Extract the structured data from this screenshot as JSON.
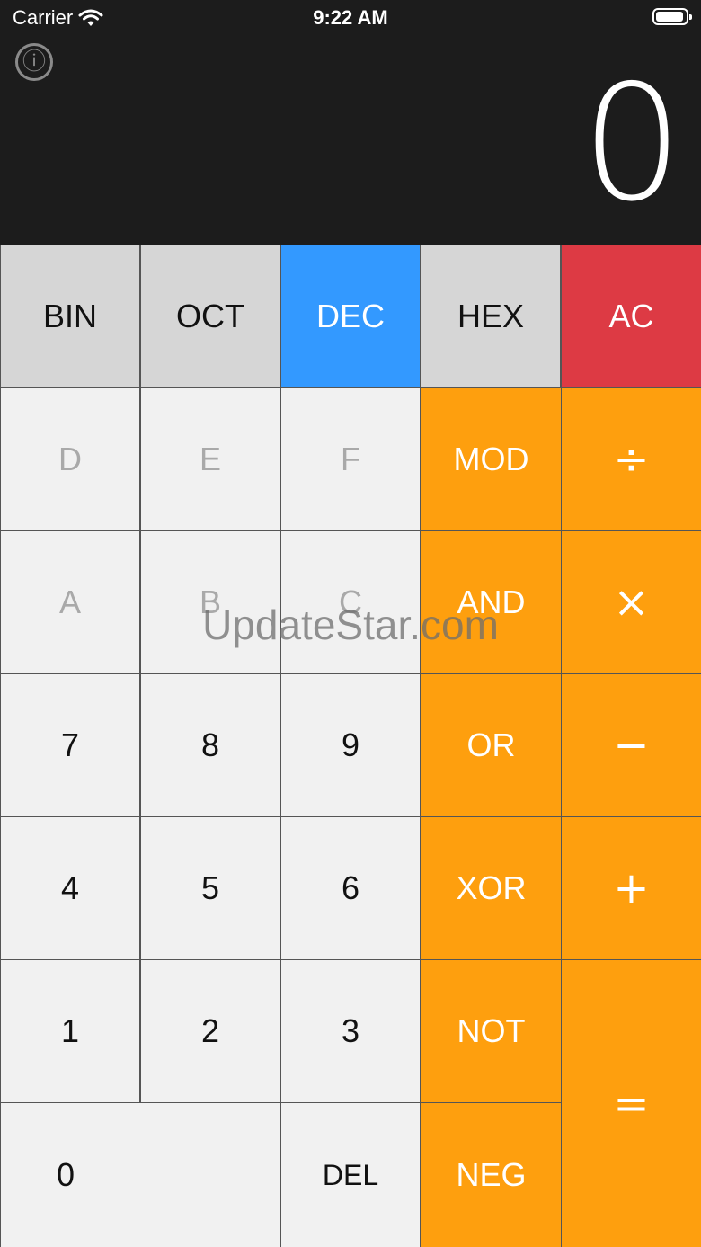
{
  "status": {
    "carrier": "Carrier",
    "time": "9:22 AM",
    "battery_level": 0.95
  },
  "info_icon": "ⓘ",
  "display": {
    "value": "0"
  },
  "colors": {
    "grey": "#d6d6d6",
    "active": "#3399ff",
    "clear": "#dd3a44",
    "operator": "#fe9f0e",
    "key": "#f1f1f1"
  },
  "modes": {
    "bin": "BIN",
    "oct": "OCT",
    "dec": "DEC",
    "hex": "HEX",
    "selected": "DEC"
  },
  "clear": "AC",
  "hex_digits": {
    "a": "A",
    "b": "B",
    "c": "C",
    "d": "D",
    "e": "E",
    "f": "F"
  },
  "digits": {
    "d0": "0",
    "d1": "1",
    "d2": "2",
    "d3": "3",
    "d4": "4",
    "d5": "5",
    "d6": "6",
    "d7": "7",
    "d8": "8",
    "d9": "9"
  },
  "del": "DEL",
  "logic": {
    "mod": "MOD",
    "and": "AND",
    "or": "OR",
    "xor": "XOR",
    "not": "NOT",
    "neg": "NEG"
  },
  "arith": {
    "divide": "÷",
    "multiply": "×",
    "minus": "−",
    "plus": "+",
    "equals": "="
  },
  "watermark": "UpdateStar.com"
}
